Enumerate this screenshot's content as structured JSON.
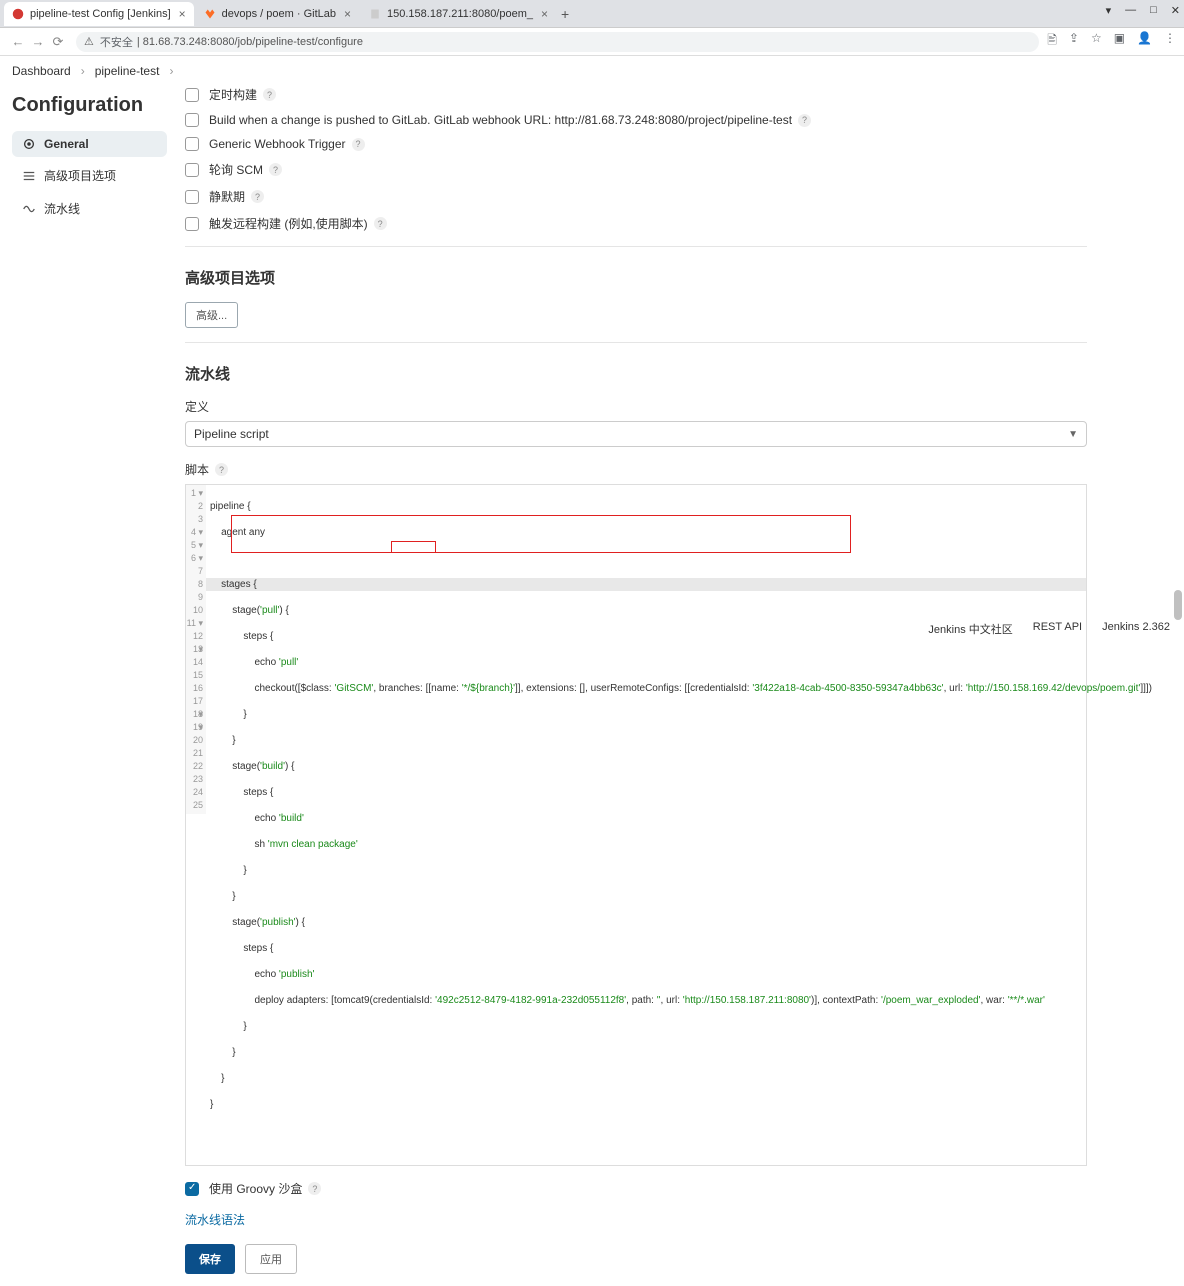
{
  "window": {
    "tabs": [
      {
        "title": "pipeline-test Config [Jenkins]",
        "active": true
      },
      {
        "title": "devops / poem · GitLab",
        "active": false
      },
      {
        "title": "150.158.187.211:8080/poem_",
        "active": false
      }
    ],
    "url_prefix": "不安全",
    "url": "81.68.73.248:8080/job/pipeline-test/configure"
  },
  "breadcrumb": {
    "items": [
      "Dashboard",
      "pipeline-test"
    ]
  },
  "sidebar": {
    "title": "Configuration",
    "items": [
      {
        "label": "General",
        "icon": "gear"
      },
      {
        "label": "高级项目选项",
        "icon": "list"
      },
      {
        "label": "流水线",
        "icon": "pipeline"
      }
    ]
  },
  "triggers": {
    "rows": [
      {
        "label": "定时构建",
        "help": true
      },
      {
        "label": "Build when a change is pushed to GitLab. GitLab webhook URL: http://81.68.73.248:8080/project/pipeline-test",
        "help": true
      },
      {
        "label": "Generic Webhook Trigger",
        "help": true
      },
      {
        "label": "轮询 SCM",
        "help": true
      },
      {
        "label": "静默期",
        "help": true
      },
      {
        "label": "触发远程构建 (例如,使用脚本)",
        "help": true
      }
    ]
  },
  "advanced": {
    "heading": "高级项目选项",
    "button": "高级..."
  },
  "pipeline": {
    "heading": "流水线",
    "def_label": "定义",
    "def_value": "Pipeline script",
    "script_label": "脚本",
    "sandbox_label": "使用 Groovy 沙盒",
    "syntax_link": "流水线语法",
    "code_lines": [
      "pipeline {",
      "    agent any",
      "",
      "    stages {",
      "        stage('pull') {",
      "            steps {",
      "                echo 'pull'",
      "                checkout([$class: 'GitSCM', branches: [[name: '*/${branch}']], extensions: [], userRemoteConfigs: [[credentialsId: '3f422a18-4cab-4500-8350-59347a4bb63c', url: 'http://150.158.169.42/devops/poem.git']]])",
      "            }",
      "        }",
      "        stage('build') {",
      "            steps {",
      "                echo 'build'",
      "                sh 'mvn clean package'",
      "            }",
      "        }",
      "        stage('publish') {",
      "            steps {",
      "                echo 'publish'",
      "                deploy adapters: [tomcat9(credentialsId: '492c2512-8479-4182-991a-232d055112f8', path: '', url: 'http://150.158.187.211:8080')], contextPath: '/poem_war_exploded', war: '**/*.war'",
      "            }",
      "        }",
      "    }",
      "}",
      ""
    ]
  },
  "buttons": {
    "save": "保存",
    "apply": "应用"
  },
  "footer": {
    "community": "Jenkins 中文社区",
    "rest": "REST API",
    "version": "Jenkins 2.362"
  }
}
